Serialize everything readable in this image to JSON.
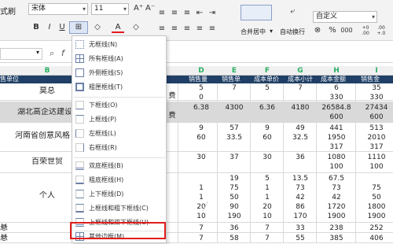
{
  "ribbon": {
    "left_text": "式刷",
    "font_name": "宋体",
    "font_size": "11",
    "grow_font": "A⁺",
    "shrink_font": "A⁻",
    "bold": "B",
    "italic": "I",
    "underline": "U",
    "borders_button": "⊞",
    "fill_button": "◇",
    "font_color_button": "A",
    "erase_button": "◇",
    "merge_center": "合并居中",
    "wrap_text": "自动换行",
    "number_format": "自定义",
    "percent": "%",
    "thousands": "000",
    "inc_decimal": "+0 .00",
    "dec_decimal": ".00 +.0"
  },
  "formula_bar": {
    "zoom_icon": "search-icon",
    "fx": "f"
  },
  "columns": [
    "B",
    "D",
    "E",
    "F",
    "G",
    "H",
    "I"
  ],
  "header_row": [
    "售单位",
    "销售量",
    "销售单",
    "成本单价",
    "成本小计",
    "成本金额",
    "销售金"
  ],
  "menu": {
    "items": [
      {
        "label": "无框线(N)"
      },
      {
        "label": "所有框线(A)"
      },
      {
        "label": "外侧框线(S)"
      },
      {
        "label": "粗匣框线(T)"
      },
      {
        "label": "下框线(O)"
      },
      {
        "label": "上框线(P)"
      },
      {
        "label": "左框线(L)"
      },
      {
        "label": "右框线(R)"
      },
      {
        "label": "双底框线(B)"
      },
      {
        "label": "粗底框线(H)"
      },
      {
        "label": "上下框线(D)"
      },
      {
        "label": "上框线和粗下框线(C)"
      },
      {
        "label": "上框线和双下框线(U)"
      },
      {
        "label": "其他边框(M)..."
      }
    ]
  },
  "rows": [
    {
      "name": "莫总",
      "extra": "费",
      "cells": [
        "5\n0",
        "7",
        "5",
        "7",
        "6\n330",
        "35\n330"
      ]
    },
    {
      "name": "湖北高企达建设",
      "extra": "费",
      "cells": [
        "6.38",
        "4300",
        "6.36",
        "4180",
        "26584.8\n600",
        "27434\n600"
      ]
    },
    {
      "name": "河南省创意风格",
      "extra": "",
      "cells": [
        "9\n60",
        "57\n33.5",
        "9\n60",
        "49\n32.5",
        "441\n1950\n317",
        "513\n2010\n317"
      ]
    },
    {
      "name": "百荣世贸",
      "extra": "",
      "cells": [
        "30",
        "37",
        "30",
        "36",
        "1080\n100",
        "1110\n100"
      ]
    },
    {
      "name": "个人",
      "extra": "",
      "cells": [
        "\n1\n1\n20\n10",
        "19\n75\n50\n90\n190",
        "5\n1\n1\n20\n10",
        "13.5\n73\n42\n86\n170",
        "67.5\n73\n42\n1720\n1900",
        "\n75\n50\n1800\n1900"
      ]
    },
    {
      "name": "悬",
      "extra": "",
      "cells": [
        "7",
        "36",
        "7",
        "33",
        "238",
        "252"
      ]
    },
    {
      "name": "悬",
      "extra": "",
      "cells": [
        "7",
        "58",
        "7",
        "55",
        "385",
        "406"
      ]
    }
  ],
  "colors": {
    "accent": "#1f3f66",
    "highlight": "#e11d1d",
    "column_letter": "#27ae60"
  }
}
